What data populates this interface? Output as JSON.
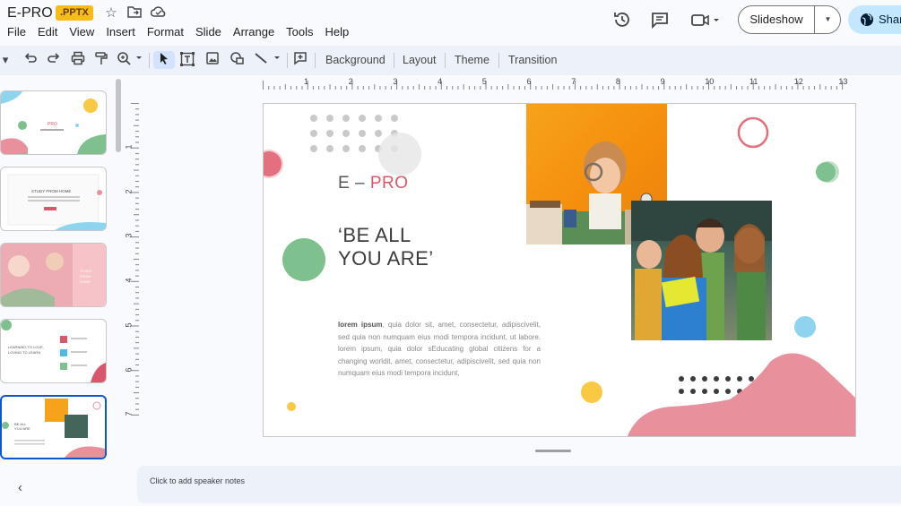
{
  "app": {
    "title": "E-PRO",
    "file_badge": ".PPTX"
  },
  "menu": [
    "File",
    "Edit",
    "View",
    "Insert",
    "Format",
    "Slide",
    "Arrange",
    "Tools",
    "Help"
  ],
  "header": {
    "slideshow_label": "Slideshow",
    "share_label": "Share"
  },
  "toolbar": {
    "background_label": "Background",
    "layout_label": "Layout",
    "theme_label": "Theme",
    "transition_label": "Transition"
  },
  "ruler": {
    "horizontal": [
      "1",
      "2",
      "3",
      "4",
      "5",
      "6",
      "7",
      "8",
      "9",
      "10",
      "11",
      "12",
      "13"
    ],
    "vertical": [
      "1",
      "2",
      "3",
      "4",
      "5",
      "6",
      "7"
    ]
  },
  "slide": {
    "title_prefix": "E – ",
    "title_accent": "PRO",
    "heading_line1": "‘BE ALL",
    "heading_line2": "YOU ARE’",
    "body_bold": "lorem ipsum",
    "body_text": ", quia dolor sit, amet, consectetur, adipiscivelit, sed quia non numquam eius modi tempora incidunt, ut labore. lorem ipsum, quia dolor sEducating global citizens for a changing worldit, amet, consectetur, adipiscivelit, sed quia non numquam eius modi tempora incidunt,"
  },
  "notes": {
    "placeholder": "Click to add speaker notes"
  },
  "colors": {
    "accent_pink": "#e8909c",
    "accent_green": "#7fc08f",
    "accent_yellow": "#f9bc15",
    "accent_blue": "#8ed4ef",
    "selection_blue": "#0b57d0"
  }
}
